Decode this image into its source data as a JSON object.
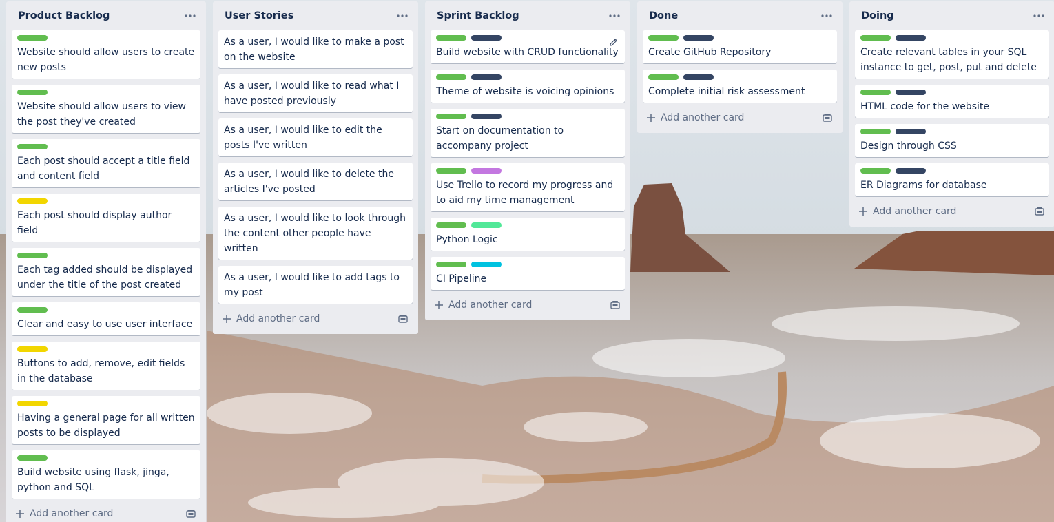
{
  "colors": {
    "green": "#61bd4f",
    "navy": "#344563",
    "yellow": "#f2d600",
    "purple": "#c377e0",
    "lime": "#51e898",
    "sky": "#00c2e0"
  },
  "add_card_label": "Add another card",
  "lists": [
    {
      "title": "Product Backlog",
      "cards": [
        {
          "title": "Website should allow users to create new posts",
          "labels": [
            "green"
          ]
        },
        {
          "title": "Website should allow users to view the post they've created",
          "labels": [
            "green"
          ]
        },
        {
          "title": "Each post should accept a title field and content field",
          "labels": [
            "green"
          ]
        },
        {
          "title": "Each post should display author field",
          "labels": [
            "yellow"
          ]
        },
        {
          "title": "Each tag added should be displayed under the title of the post created",
          "labels": [
            "green"
          ]
        },
        {
          "title": "Clear and easy to use user interface",
          "labels": [
            "green"
          ]
        },
        {
          "title": "Buttons to add, remove, edit fields in the database",
          "labels": [
            "yellow"
          ]
        },
        {
          "title": "Having a general page for all written posts to be displayed",
          "labels": [
            "yellow"
          ]
        },
        {
          "title": "Build website using flask, jinga, python and SQL",
          "labels": [
            "green"
          ]
        }
      ]
    },
    {
      "title": "User Stories",
      "cards": [
        {
          "title": "As a user, I would like to make a post on the website",
          "labels": []
        },
        {
          "title": "As a user, I would like to read what I have posted previously",
          "labels": []
        },
        {
          "title": "As a user, I would like to edit the posts I've written",
          "labels": []
        },
        {
          "title": "As a user, I would like to delete the articles I've posted",
          "labels": []
        },
        {
          "title": "As a user, I would like to look through the content other people have written",
          "labels": []
        },
        {
          "title": "As a user, I would like to add tags to my post",
          "labels": []
        }
      ]
    },
    {
      "title": "Sprint Backlog",
      "cards": [
        {
          "title": "Build website with CRUD functionality",
          "labels": [
            "green",
            "navy"
          ],
          "editing": true
        },
        {
          "title": "Theme of website is voicing opinions",
          "labels": [
            "green",
            "navy"
          ]
        },
        {
          "title": "Start on documentation to accompany project",
          "labels": [
            "green",
            "navy"
          ]
        },
        {
          "title": "Use Trello to record my progress and to aid my time management",
          "labels": [
            "green",
            "purple"
          ]
        },
        {
          "title": "Python Logic",
          "labels": [
            "green",
            "lime"
          ]
        },
        {
          "title": "CI Pipeline",
          "labels": [
            "green",
            "sky"
          ]
        }
      ]
    },
    {
      "title": "Done",
      "cards": [
        {
          "title": "Create GitHub Repository",
          "labels": [
            "green",
            "navy"
          ]
        },
        {
          "title": "Complete initial risk assessment",
          "labels": [
            "green",
            "navy"
          ]
        }
      ]
    },
    {
      "title": "Doing",
      "cards": [
        {
          "title": "Create relevant tables in your SQL instance to get, post, put and delete",
          "labels": [
            "green",
            "navy"
          ]
        },
        {
          "title": "HTML code for the website",
          "labels": [
            "green",
            "navy"
          ]
        },
        {
          "title": "Design through CSS",
          "labels": [
            "green",
            "navy"
          ]
        },
        {
          "title": "ER Diagrams for database",
          "labels": [
            "green",
            "navy"
          ]
        }
      ]
    }
  ]
}
